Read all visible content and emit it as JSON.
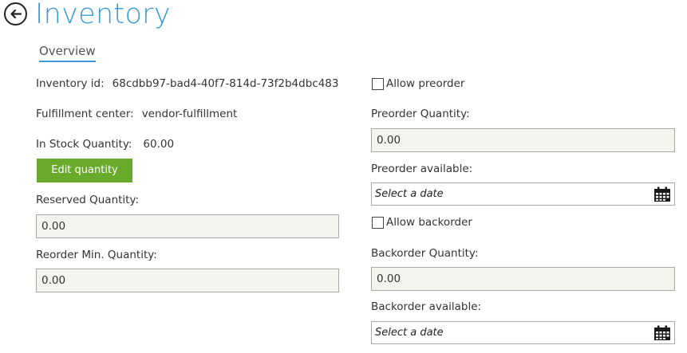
{
  "header": {
    "title": "Inventory"
  },
  "tabs": {
    "overview": "Overview"
  },
  "left": {
    "inventory_id_label": "Inventory id:",
    "inventory_id_value": "68cdbb97-bad4-40f7-814d-73f2b4dbc483",
    "fulfillment_label": "Fulfillment center:",
    "fulfillment_value": "vendor-fulfillment",
    "instock_label": "In Stock Quantity:",
    "instock_value": "60.00",
    "edit_button": "Edit quantity",
    "reserved_label": "Reserved Quantity:",
    "reserved_value": "0.00",
    "reorder_label": "Reorder Min. Quantity:",
    "reorder_value": "0.00"
  },
  "right": {
    "allow_preorder_label": "Allow preorder",
    "preorder_qty_label": "Preorder Quantity:",
    "preorder_qty_value": "0.00",
    "preorder_available_label": "Preorder available:",
    "preorder_date_placeholder": "Select a date",
    "allow_backorder_label": "Allow backorder",
    "backorder_qty_label": "Backorder Quantity:",
    "backorder_qty_value": "0.00",
    "backorder_available_label": "Backorder available:",
    "backorder_date_placeholder": "Select a date"
  },
  "icons": {
    "back": "back-arrow-icon",
    "calendar": "calendar-icon"
  },
  "colors": {
    "accent": "#3a9ad9",
    "button": "#6aaa2b",
    "field_bg": "#f4f4ee"
  }
}
